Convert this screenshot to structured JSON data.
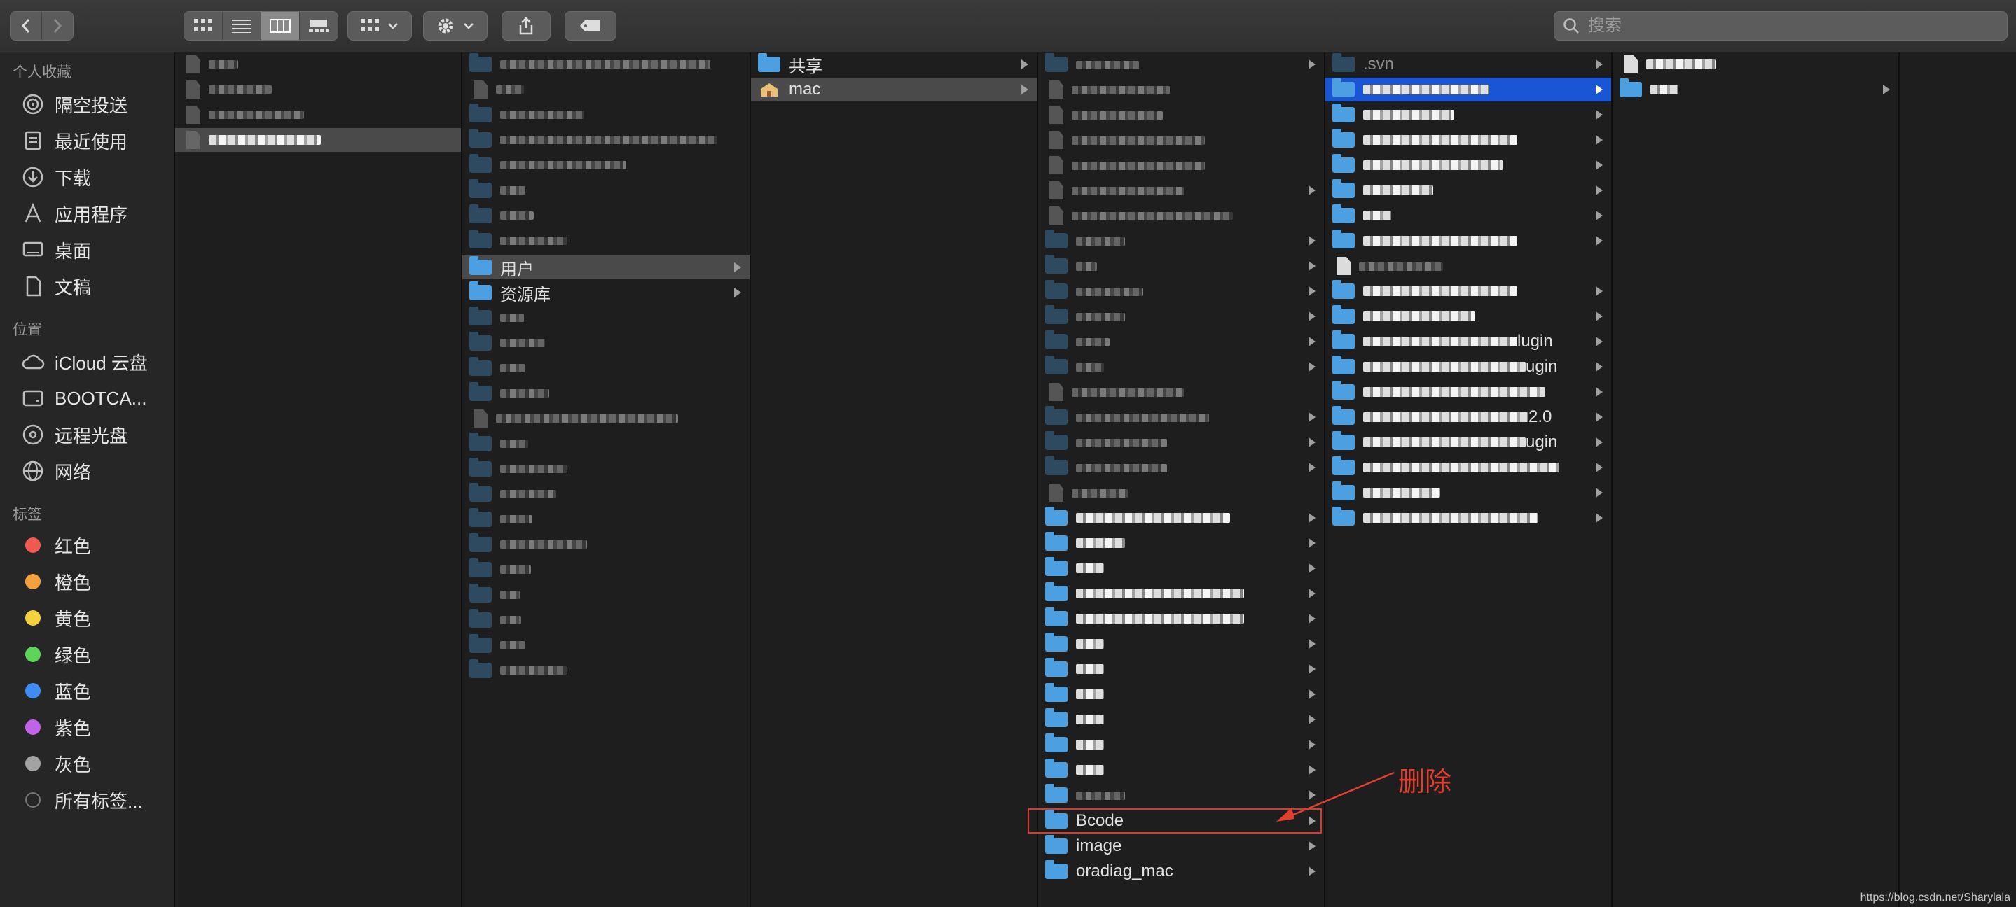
{
  "toolbar": {
    "search_placeholder": "搜索"
  },
  "sidebar": {
    "favorites_title": "个人收藏",
    "favorites": [
      {
        "label": "隔空投送",
        "icon": "airdrop-icon"
      },
      {
        "label": "最近使用",
        "icon": "recents-icon"
      },
      {
        "label": "下载",
        "icon": "downloads-icon"
      },
      {
        "label": "应用程序",
        "icon": "applications-icon"
      },
      {
        "label": "桌面",
        "icon": "desktop-icon"
      },
      {
        "label": "文稿",
        "icon": "documents-icon"
      }
    ],
    "locations_title": "位置",
    "locations": [
      {
        "label": "iCloud 云盘",
        "icon": "icloud-icon"
      },
      {
        "label": "BOOTCA...",
        "icon": "disk-icon"
      },
      {
        "label": "远程光盘",
        "icon": "optical-disc-icon"
      },
      {
        "label": "网络",
        "icon": "network-icon"
      }
    ],
    "tags_title": "标签",
    "tags": [
      {
        "label": "红色",
        "color": "#f0594f"
      },
      {
        "label": "橙色",
        "color": "#f5a140"
      },
      {
        "label": "黄色",
        "color": "#f4d13f"
      },
      {
        "label": "绿色",
        "color": "#5dd55a"
      },
      {
        "label": "蓝色",
        "color": "#3f8cf5"
      },
      {
        "label": "紫色",
        "color": "#c064e6"
      },
      {
        "label": "灰色",
        "color": "#a3a3a3"
      },
      {
        "label": "所有标签...",
        "color": ""
      }
    ]
  },
  "columns": {
    "col2": {
      "users": "用户",
      "library": "资源库"
    },
    "col3": {
      "shared": "共享",
      "home": "mac"
    },
    "col4": {
      "bcode": "Bcode",
      "image": "image",
      "oradiag": "oradiag_mac"
    },
    "col5": {
      "svn": ".svn",
      "partial_1": "lugin",
      "partial_2": "ugin",
      "partial_3": "2.0",
      "partial_4": "ugin"
    }
  },
  "annotation": {
    "label": "删除"
  },
  "watermark": "https://blog.csdn.net/Sharylala"
}
